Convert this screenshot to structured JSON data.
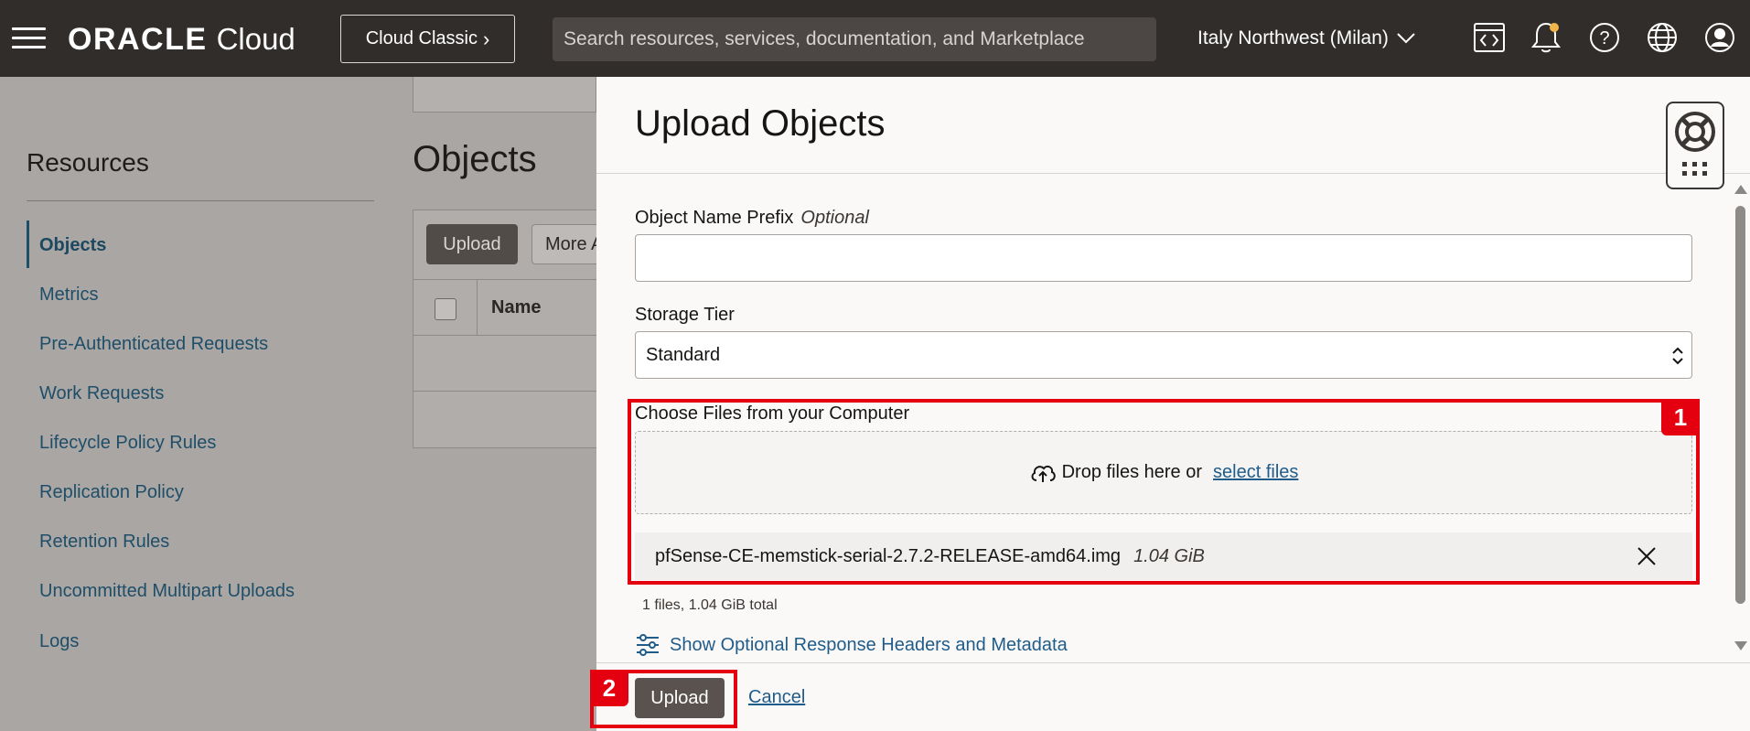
{
  "topbar": {
    "logo_oracle": "ORACLE",
    "logo_cloud": "Cloud",
    "classic_label": "Cloud Classic",
    "search_placeholder": "Search resources, services, documentation, and Marketplace",
    "region": "Italy Northwest (Milan)",
    "icons": [
      "developer-tools-icon",
      "notifications-bell-icon",
      "help-icon",
      "language-globe-icon",
      "user-profile-icon"
    ]
  },
  "sidebar": {
    "title": "Resources",
    "items": [
      {
        "label": "Objects",
        "active": true
      },
      {
        "label": "Metrics"
      },
      {
        "label": "Pre-Authenticated Requests"
      },
      {
        "label": "Work Requests"
      },
      {
        "label": "Lifecycle Policy Rules"
      },
      {
        "label": "Replication Policy"
      },
      {
        "label": "Retention Rules"
      },
      {
        "label": "Uncommitted Multipart Uploads"
      },
      {
        "label": "Logs"
      }
    ]
  },
  "objects": {
    "title": "Objects",
    "upload_label": "Upload",
    "more_label": "More A",
    "name_column": "Name"
  },
  "panel": {
    "title": "Upload Objects",
    "prefix_label": "Object Name Prefix",
    "prefix_optional": "Optional",
    "prefix_value": "",
    "storage_tier_label": "Storage Tier",
    "storage_tier_value": "Standard",
    "choose_files_label": "Choose Files from your Computer",
    "drop_text": "Drop files here or",
    "select_files_link": "select files",
    "file": {
      "name": "pfSense-CE-memstick-serial-2.7.2-RELEASE-amd64.img",
      "size": "1.04 GiB"
    },
    "total_text": "1 files, 1.04 GiB total",
    "optional_headers_link": "Show Optional Response Headers and Metadata",
    "upload_button": "Upload",
    "cancel_link": "Cancel"
  },
  "annotations": {
    "badge_1": "1",
    "badge_2": "2",
    "color": "#e4000f"
  },
  "colors": {
    "topbar": "#312d2a",
    "link": "#1f5c8a",
    "primary_button": "#5a524e",
    "highlight_red": "#e4000f"
  }
}
